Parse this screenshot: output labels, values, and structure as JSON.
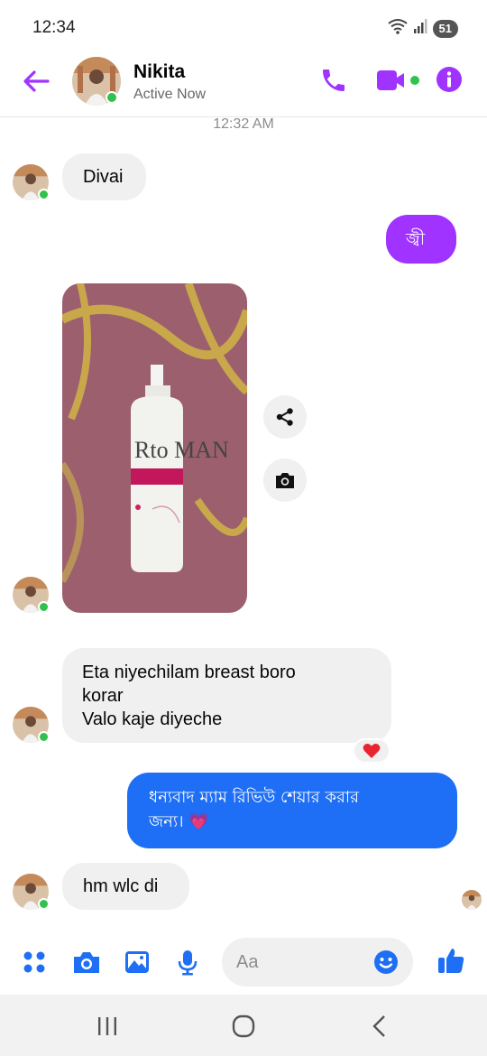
{
  "status_bar": {
    "time": "12:34",
    "battery": "51"
  },
  "header": {
    "name": "Nikita",
    "status": "Active Now"
  },
  "chat": {
    "timestamp": "12:32 AM",
    "messages": [
      {
        "text": "Divai"
      },
      {
        "text": "জ্বী"
      },
      {
        "text": "Rto MAN"
      },
      {
        "lines": [
          "Eta niyechilam breast boro",
          "korar",
          "Valo kaje diyeche"
        ],
        "reaction": "❤️"
      },
      {
        "lines": [
          "ধন্যবাদ ম্যাম রিভিউ শেয়ার করার",
          "জন্য। 💗"
        ]
      },
      {
        "text": "hm wlc di"
      }
    ]
  },
  "composer": {
    "placeholder": "Aa"
  },
  "colors": {
    "accent": "#a033ff",
    "messenger_blue": "#1e6ff5",
    "online": "#31c24d"
  }
}
